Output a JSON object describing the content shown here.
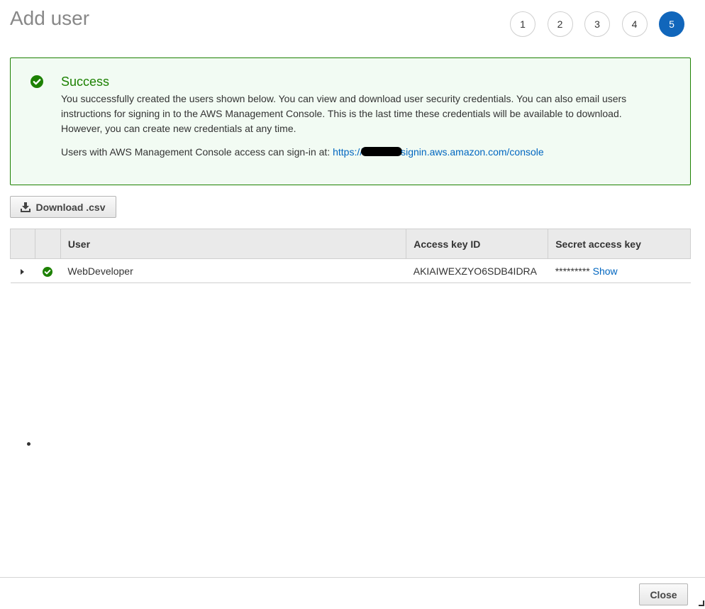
{
  "page": {
    "title": "Add user"
  },
  "steps": [
    {
      "label": "1",
      "active": false
    },
    {
      "label": "2",
      "active": false
    },
    {
      "label": "3",
      "active": false
    },
    {
      "label": "4",
      "active": false
    },
    {
      "label": "5",
      "active": true
    }
  ],
  "alert": {
    "icon": "check-circle-icon",
    "title": "Success",
    "body": "You successfully created the users shown below. You can view and download user security credentials. You can also email users instructions for signing in to the AWS Management Console. This is the last time these credentials will be available to download. However, you can create new credentials at any time.",
    "signin_prefix": "Users with AWS Management Console access can sign-in at: ",
    "signin_link_start": "https://",
    "signin_link_end": "signin.aws.amazon.com/console",
    "color": "#1d8102"
  },
  "toolbar": {
    "download_label": "Download .csv",
    "download_icon": "download-icon"
  },
  "table": {
    "columns": [
      "User",
      "Access key ID",
      "Secret access key"
    ],
    "rows": [
      {
        "user": "WebDeveloper",
        "access_key_id": "AKIAIWEXZYO6SDB4IDRA",
        "secret_masked": "*********",
        "show_label": "Show"
      }
    ]
  },
  "footer": {
    "close_label": "Close"
  },
  "colors": {
    "accent": "#1166bb",
    "link": "#0066c0",
    "success": "#1d8102"
  }
}
